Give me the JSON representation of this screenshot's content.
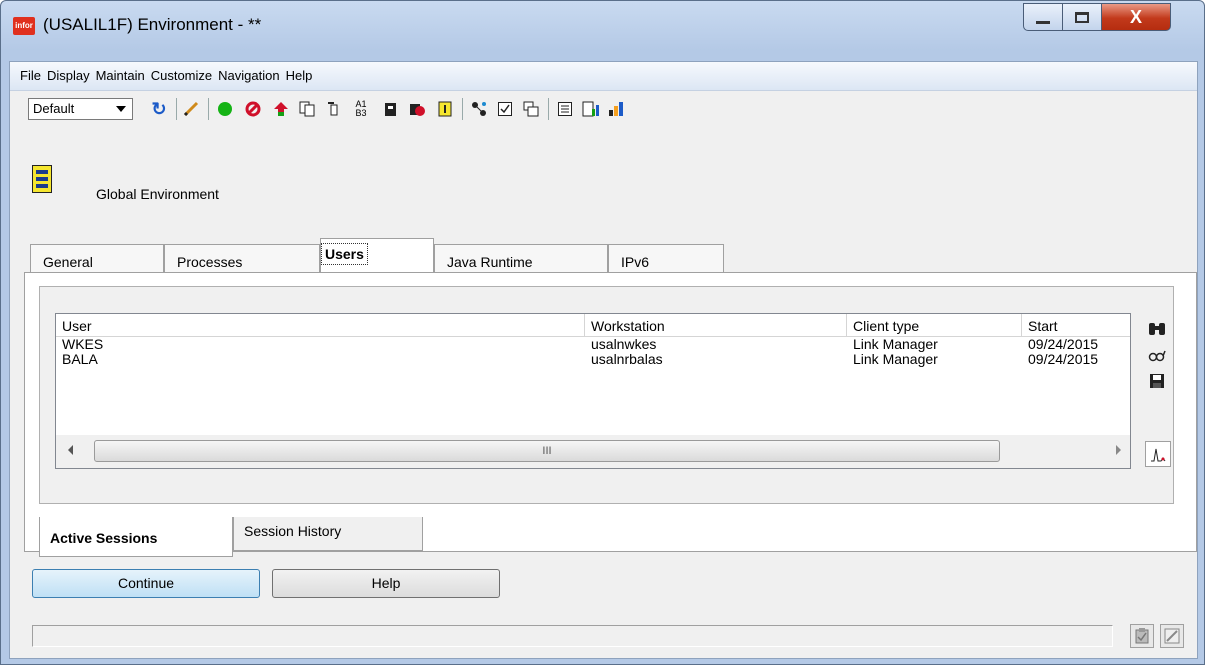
{
  "window": {
    "app_icon_text": "infor",
    "title": "(USALIL1F) Environment - **",
    "minimize_glyph": "—",
    "maximize_glyph": "☐",
    "close_glyph": "X"
  },
  "menubar": {
    "items": [
      "File",
      "Display",
      "Maintain",
      "Customize",
      "Navigation",
      "Help"
    ]
  },
  "toolbar": {
    "profile_value": "Default",
    "icons": [
      "refresh-icon",
      "pencil-icon",
      "green-circle-icon",
      "stop-icon",
      "up-arrow-icon",
      "copy-icon",
      "filter-icon",
      "a1b3-icon",
      "clipboard-icon",
      "block-icon",
      "yellow-doc-icon",
      "network-icon",
      "check-icon",
      "windows-icon",
      "list-icon",
      "chart-icon",
      "grid-icon"
    ]
  },
  "header": {
    "label": "Global Environment"
  },
  "tabs": [
    {
      "label": "General"
    },
    {
      "label": "Processes"
    },
    {
      "label": "Users"
    },
    {
      "label": "Java Runtime"
    },
    {
      "label": "IPv6"
    }
  ],
  "grid": {
    "columns": [
      "User",
      "Workstation",
      "Client type",
      "Start"
    ],
    "rows": [
      [
        "WKES",
        "usalnwkes",
        "Link Manager",
        "09/24/2015"
      ],
      [
        "BALA",
        "usalnrbalas",
        "Link Manager",
        "09/24/2015"
      ]
    ],
    "scroll_thumb_glyph": "III"
  },
  "side_tools": [
    "binoculars-icon",
    "glasses-icon",
    "save-icon",
    "graph-icon"
  ],
  "subtabs": [
    {
      "label": "Active Sessions"
    },
    {
      "label": "Session History"
    }
  ],
  "buttons": {
    "continue": "Continue",
    "help": "Help"
  },
  "status": {
    "text": ""
  },
  "colors": {
    "title_bg": "#b4c9e6",
    "close_red": "#c2391b",
    "accent_blue": "#3c7fb1"
  }
}
